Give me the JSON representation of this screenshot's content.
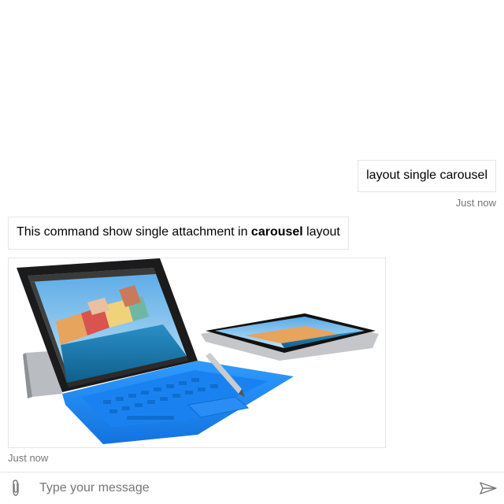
{
  "transcript": {
    "user_message": {
      "text": "layout single carousel",
      "timestamp": "Just now"
    },
    "bot_message": {
      "text_before": "This command show single attachment in ",
      "text_bold": "carousel",
      "text_after": " layout",
      "timestamp": "Just now"
    },
    "attachment": {
      "type": "image",
      "subject": "tablet-with-blue-keyboard-and-stylus"
    }
  },
  "composer": {
    "placeholder": "Type your message",
    "value": "",
    "attach_icon": "paperclip-icon",
    "send_icon": "send-icon"
  },
  "colors": {
    "background": "#ffffff",
    "bubble_border": "#e6e6e6",
    "timestamp": "#767676",
    "keyboard_blue": "#1e90ff"
  }
}
